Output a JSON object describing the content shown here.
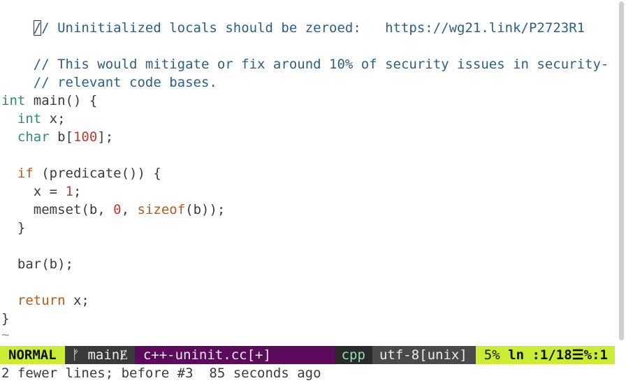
{
  "buffer": {
    "line1_cursor_char": "/",
    "line1_rest": "/ Uninitialized locals should be zeroed:   https://wg21.link/P2723R1",
    "line3": "// This would mitigate or fix around 10% of security issues in security-",
    "line4": "// relevant code bases.",
    "kw_int": "int",
    "fn_main": " main() {",
    "indent2": "  ",
    "indent4": "    ",
    "var_x_decl": " x;",
    "kw_char": "char",
    "b_open": " b[",
    "num_100": "100",
    "b_close": "];",
    "kw_if": "if",
    "if_cond": " (predicate()) {",
    "x_assign": "x = ",
    "num_1": "1",
    "semicolon": ";",
    "memset_open": "memset(b, ",
    "num_0": "0",
    "comma_space": ", ",
    "kw_sizeof": "sizeof",
    "sizeof_arg": "(b));",
    "close_brace_inner": "}",
    "bar_call": "bar(b);",
    "kw_return": "return",
    "return_x": " x;",
    "close_brace_outer": "}",
    "end_of_buffer": "~"
  },
  "statusline": {
    "mode": "NORMAL",
    "branch": "ᚠ main",
    "branch_suffix": "Ɇ",
    "filename": "c++-uninit.cc[+]",
    "filetype": "cpp",
    "encoding": "utf-8[unix]",
    "percent": "5%",
    "position": "ln :1/18",
    "column_sep": "☰%:1"
  },
  "cmdline": {
    "message": "2 fewer lines; before #3  85 seconds ago"
  }
}
